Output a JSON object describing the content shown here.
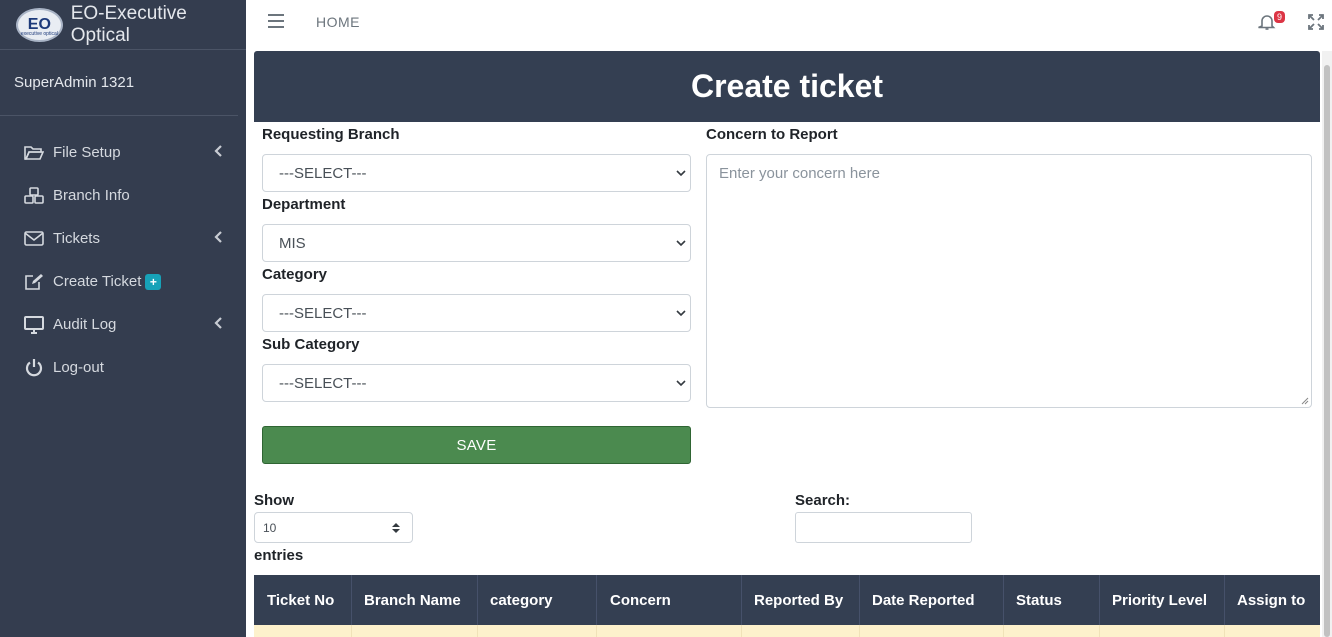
{
  "brand": {
    "name": "EO-Executive Optical",
    "logo_text": "EO",
    "logo_subtext": "executive optical"
  },
  "user": {
    "name": "SuperAdmin 1321"
  },
  "sidebar": {
    "items": [
      {
        "label": "File Setup",
        "icon": "folder-open-icon",
        "has_submenu": true
      },
      {
        "label": "Branch Info",
        "icon": "cubes-icon",
        "has_submenu": false
      },
      {
        "label": "Tickets",
        "icon": "envelope-icon",
        "has_submenu": true
      },
      {
        "label": "Create Ticket",
        "icon": "edit-icon",
        "has_submenu": false,
        "badge": "+"
      },
      {
        "label": "Audit Log",
        "icon": "desktop-icon",
        "has_submenu": true
      },
      {
        "label": "Log-out",
        "icon": "power-icon",
        "has_submenu": false
      }
    ]
  },
  "topbar": {
    "home_label": "HOME",
    "notification_count": "9"
  },
  "form": {
    "title": "Create ticket",
    "requesting_branch": {
      "label": "Requesting Branch",
      "value": "---SELECT---"
    },
    "department": {
      "label": "Department",
      "value": "MIS"
    },
    "category": {
      "label": "Category",
      "value": "---SELECT---"
    },
    "sub_category": {
      "label": "Sub Category",
      "value": "---SELECT---"
    },
    "concern": {
      "label": "Concern to Report",
      "placeholder": "Enter your concern here"
    },
    "save_label": "SAVE"
  },
  "table_controls": {
    "show_label": "Show",
    "entries_value": "10",
    "entries_label": "entries",
    "search_label": "Search:",
    "search_value": ""
  },
  "table": {
    "columns": [
      "Ticket No",
      "Branch Name",
      "category",
      "Concern",
      "Reported By",
      "Date Reported",
      "Status",
      "Priority Level",
      "Assign to"
    ]
  },
  "colors": {
    "sidebar_bg": "#343d4f",
    "header_bg": "#343f52",
    "save_button": "#4b8a4f",
    "row_highlight": "#fdf1cc",
    "badge_info": "#17a2b8",
    "badge_danger": "#dc3545"
  }
}
